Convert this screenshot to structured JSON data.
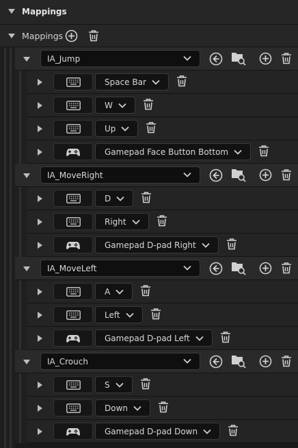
{
  "header": {
    "title": "Mappings"
  },
  "mappings": {
    "label": "Mappings"
  },
  "actions": [
    {
      "name": "IA_Jump",
      "keys": [
        {
          "device": "keyboard",
          "label": "Space Bar"
        },
        {
          "device": "keyboard",
          "label": "W"
        },
        {
          "device": "keyboard",
          "label": "Up"
        },
        {
          "device": "gamepad",
          "label": "Gamepad Face Button Bottom"
        }
      ]
    },
    {
      "name": "IA_MoveRight",
      "keys": [
        {
          "device": "keyboard",
          "label": "D"
        },
        {
          "device": "keyboard",
          "label": "Right"
        },
        {
          "device": "gamepad",
          "label": "Gamepad D-pad Right"
        }
      ]
    },
    {
      "name": "IA_MoveLeft",
      "keys": [
        {
          "device": "keyboard",
          "label": "A"
        },
        {
          "device": "keyboard",
          "label": "Left"
        },
        {
          "device": "gamepad",
          "label": "Gamepad D-pad Left"
        }
      ]
    },
    {
      "name": "IA_Crouch",
      "keys": [
        {
          "device": "keyboard",
          "label": "S"
        },
        {
          "device": "keyboard",
          "label": "Down"
        },
        {
          "device": "gamepad",
          "label": "Gamepad D-pad Down"
        }
      ]
    }
  ],
  "icons": {
    "expand": "triangle-down-icon",
    "collapsed": "triangle-right-icon",
    "add": "plus-circle-icon",
    "delete": "trash-icon",
    "use_selected": "arrow-left-circle-icon",
    "browse": "folder-search-icon",
    "keyboard": "keyboard-icon",
    "gamepad": "gamepad-icon",
    "dropdown": "chevron-down-icon"
  },
  "colors": {
    "background": "#1a1a1a",
    "row": "#2a2a2a",
    "field": "#0f0f0f",
    "icon": "#d0d0d0"
  }
}
